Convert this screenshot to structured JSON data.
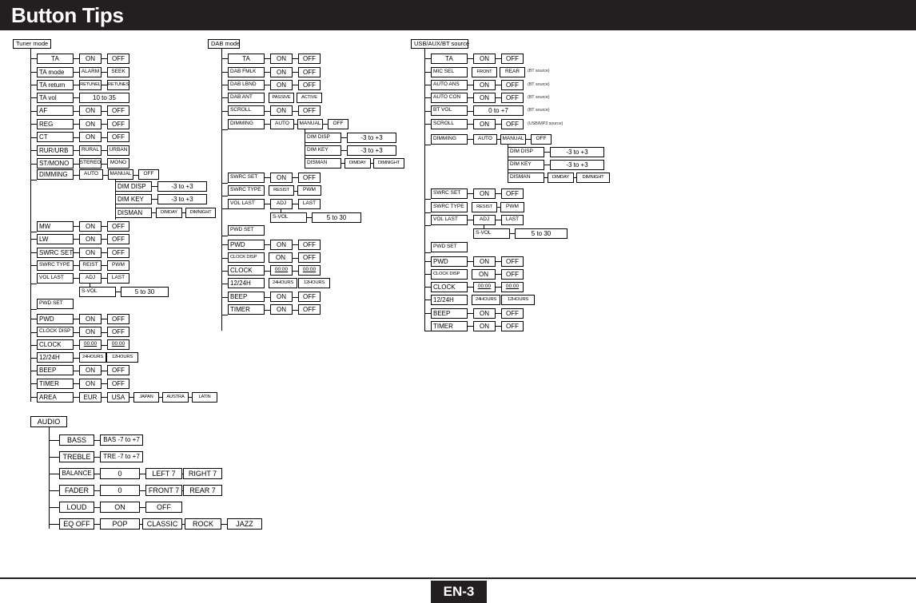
{
  "header": {
    "title": "Button Tips"
  },
  "footer": {
    "page_label": "EN-3"
  },
  "colors": {
    "header_bg": "#231f20",
    "line": "#000000",
    "page_bg": "#ffffff"
  },
  "sections": {
    "tuner": {
      "title": "Tuner mode",
      "rows": [
        {
          "label": "TA",
          "values": [
            "ON",
            "OFF"
          ]
        },
        {
          "label": "TA mode",
          "values": [
            "ALARM",
            "SEEK"
          ]
        },
        {
          "label": "TA return",
          "values": [
            "RETUNEL",
            "RETUNES"
          ]
        },
        {
          "label": "TA vol",
          "values": [
            "10 to 35"
          ]
        },
        {
          "label": "AF",
          "values": [
            "ON",
            "OFF"
          ]
        },
        {
          "label": "REG",
          "values": [
            "ON",
            "OFF"
          ]
        },
        {
          "label": "CT",
          "values": [
            "ON",
            "OFF"
          ]
        },
        {
          "label": "RUR/URB",
          "values": [
            "RURAL",
            "URBAN"
          ]
        },
        {
          "label": "ST/MONO",
          "values": [
            "STEREO",
            "MONO"
          ]
        },
        {
          "label": "DIMMING",
          "values": [
            "AUTO",
            "MANUAL",
            "OFF"
          ]
        },
        {
          "label": "DIM DISP",
          "values": [
            "-3 to +3"
          ]
        },
        {
          "label": "DIM KEY",
          "values": [
            "-3 to +3"
          ]
        },
        {
          "label": "DISMAN",
          "values": [
            "DIMDAY",
            "DIMNIGHT"
          ]
        },
        {
          "label": "MW",
          "values": [
            "ON",
            "OFF"
          ]
        },
        {
          "label": "LW",
          "values": [
            "ON",
            "OFF"
          ]
        },
        {
          "label": "SWRC SET",
          "values": [
            "ON",
            "OFF"
          ]
        },
        {
          "label": "SWRC TYPE",
          "values": [
            "REIST",
            "PWM"
          ]
        },
        {
          "label": "VOL LAST",
          "values": [
            "ADJ",
            "LAST"
          ]
        },
        {
          "label": "S-VOL",
          "values": [
            "5 to 30"
          ]
        },
        {
          "label": "PWD SET",
          "values": []
        },
        {
          "label": "PWD",
          "values": [
            "ON",
            "OFF"
          ]
        },
        {
          "label": "CLOCK DISP",
          "values": [
            "ON",
            "OFF"
          ]
        },
        {
          "label": "CLOCK",
          "values": [
            "00:00",
            "00:00"
          ]
        },
        {
          "label": "12/24H",
          "values": [
            "24HOURS",
            "12HOURS"
          ]
        },
        {
          "label": "BEEP",
          "values": [
            "ON",
            "OFF"
          ]
        },
        {
          "label": "TIMER",
          "values": [
            "ON",
            "OFF"
          ]
        },
        {
          "label": "AREA",
          "values": [
            "EUR",
            "USA",
            "JAPAN",
            "AUSTRA",
            "LATIN"
          ]
        }
      ]
    },
    "dab": {
      "title": "DAB mode",
      "rows": [
        {
          "label": "TA",
          "values": [
            "ON",
            "OFF"
          ]
        },
        {
          "label": "DAB FMLK",
          "values": [
            "ON",
            "OFF"
          ]
        },
        {
          "label": "DAB LBND",
          "values": [
            "ON",
            "OFF"
          ]
        },
        {
          "label": "DAB ANT",
          "values": [
            "PASSIVE",
            "ACTIVE"
          ]
        },
        {
          "label": "SCROLL",
          "values": [
            "ON",
            "OFF"
          ]
        },
        {
          "label": "DIMMING",
          "values": [
            "AUTO",
            "MANUAL",
            "OFF"
          ]
        },
        {
          "label": "DIM DISP",
          "values": [
            "-3 to +3"
          ]
        },
        {
          "label": "DIM KEY",
          "values": [
            "-3 to +3"
          ]
        },
        {
          "label": "DISMAN",
          "values": [
            "DIMDAY",
            "DIMNIGHT"
          ]
        },
        {
          "label": "SWRC SET",
          "values": [
            "ON",
            "OFF"
          ]
        },
        {
          "label": "SWRC TYPE",
          "values": [
            "RESIST",
            "PWM"
          ]
        },
        {
          "label": "VOL LAST",
          "values": [
            "ADJ",
            "LAST"
          ]
        },
        {
          "label": "S-VOL",
          "values": [
            "5 to 30"
          ]
        },
        {
          "label": "PWD SET",
          "values": []
        },
        {
          "label": "PWD",
          "values": [
            "ON",
            "OFF"
          ]
        },
        {
          "label": "CLOCK DISP",
          "values": [
            "ON",
            "OFF"
          ]
        },
        {
          "label": "CLOCK",
          "values": [
            "00:00",
            "00:00"
          ]
        },
        {
          "label": "12/24H",
          "values": [
            "24HOURS",
            "12HOURS"
          ]
        },
        {
          "label": "BEEP",
          "values": [
            "ON",
            "OFF"
          ]
        },
        {
          "label": "TIMER",
          "values": [
            "ON",
            "OFF"
          ]
        }
      ]
    },
    "usb": {
      "title": "USB/AUX/BT source",
      "rows": [
        {
          "label": "TA",
          "values": [
            "ON",
            "OFF"
          ],
          "note": ""
        },
        {
          "label": "MIC SEL",
          "values": [
            "FRONT",
            "REAR"
          ],
          "note": "(BT source)"
        },
        {
          "label": "AUTO ANS",
          "values": [
            "ON",
            "OFF"
          ],
          "note": "(BT source)"
        },
        {
          "label": "AUTO CON",
          "values": [
            "ON",
            "OFF"
          ],
          "note": "(BT source)"
        },
        {
          "label": "BT VOL",
          "values": [
            "0 to +7"
          ],
          "note": "(BT source)"
        },
        {
          "label": "SCROLL",
          "values": [
            "ON",
            "OFF"
          ],
          "note": "(USB/MP3  source)"
        },
        {
          "label": "DIMMING",
          "values": [
            "AUTO",
            "MANUAL",
            "OFF"
          ],
          "note": ""
        },
        {
          "label": "DIM DISP",
          "values": [
            "-3 to +3"
          ],
          "note": ""
        },
        {
          "label": "DIM KEY",
          "values": [
            "-3 to +3"
          ],
          "note": ""
        },
        {
          "label": "DISMAN",
          "values": [
            "DIMDAY",
            "DIMNIGHT"
          ],
          "note": ""
        },
        {
          "label": "SWRC SET",
          "values": [
            "ON",
            "OFF"
          ],
          "note": ""
        },
        {
          "label": "SWRC TYPE",
          "values": [
            "RESIST",
            "PWM"
          ],
          "note": ""
        },
        {
          "label": "VOL LAST",
          "values": [
            "ADJ",
            "LAST"
          ],
          "note": ""
        },
        {
          "label": "S-VOL",
          "values": [
            "5 to 30"
          ],
          "note": ""
        },
        {
          "label": "PWD SET",
          "values": [],
          "note": ""
        },
        {
          "label": "PWD",
          "values": [
            "ON",
            "OFF"
          ],
          "note": ""
        },
        {
          "label": "CLOCK DISP",
          "values": [
            "ON",
            "OFF"
          ],
          "note": ""
        },
        {
          "label": "CLOCK",
          "values": [
            "00:00",
            "00:00"
          ],
          "note": ""
        },
        {
          "label": "12/24H",
          "values": [
            "24HOURS",
            "12HOURS"
          ],
          "note": ""
        },
        {
          "label": "BEEP",
          "values": [
            "ON",
            "OFF"
          ],
          "note": ""
        },
        {
          "label": "TIMER",
          "values": [
            "ON",
            "OFF"
          ],
          "note": ""
        }
      ]
    },
    "audio": {
      "title": "AUDIO",
      "rows": [
        {
          "label": "BASS",
          "values": [
            "BAS -7 to +7"
          ]
        },
        {
          "label": "TREBLE",
          "values": [
            "TRE -7 to +7"
          ]
        },
        {
          "label": "BALANCE",
          "values": [
            "0",
            "LEFT 7",
            "RIGHT 7"
          ]
        },
        {
          "label": "FADER",
          "values": [
            "0",
            "FRONT 7",
            "REAR 7"
          ]
        },
        {
          "label": "LOUD",
          "values": [
            "ON",
            "OFF"
          ]
        },
        {
          "label": "EQ OFF",
          "values": [
            "POP",
            "CLASSIC",
            "ROCK",
            "JAZZ"
          ]
        }
      ]
    }
  }
}
